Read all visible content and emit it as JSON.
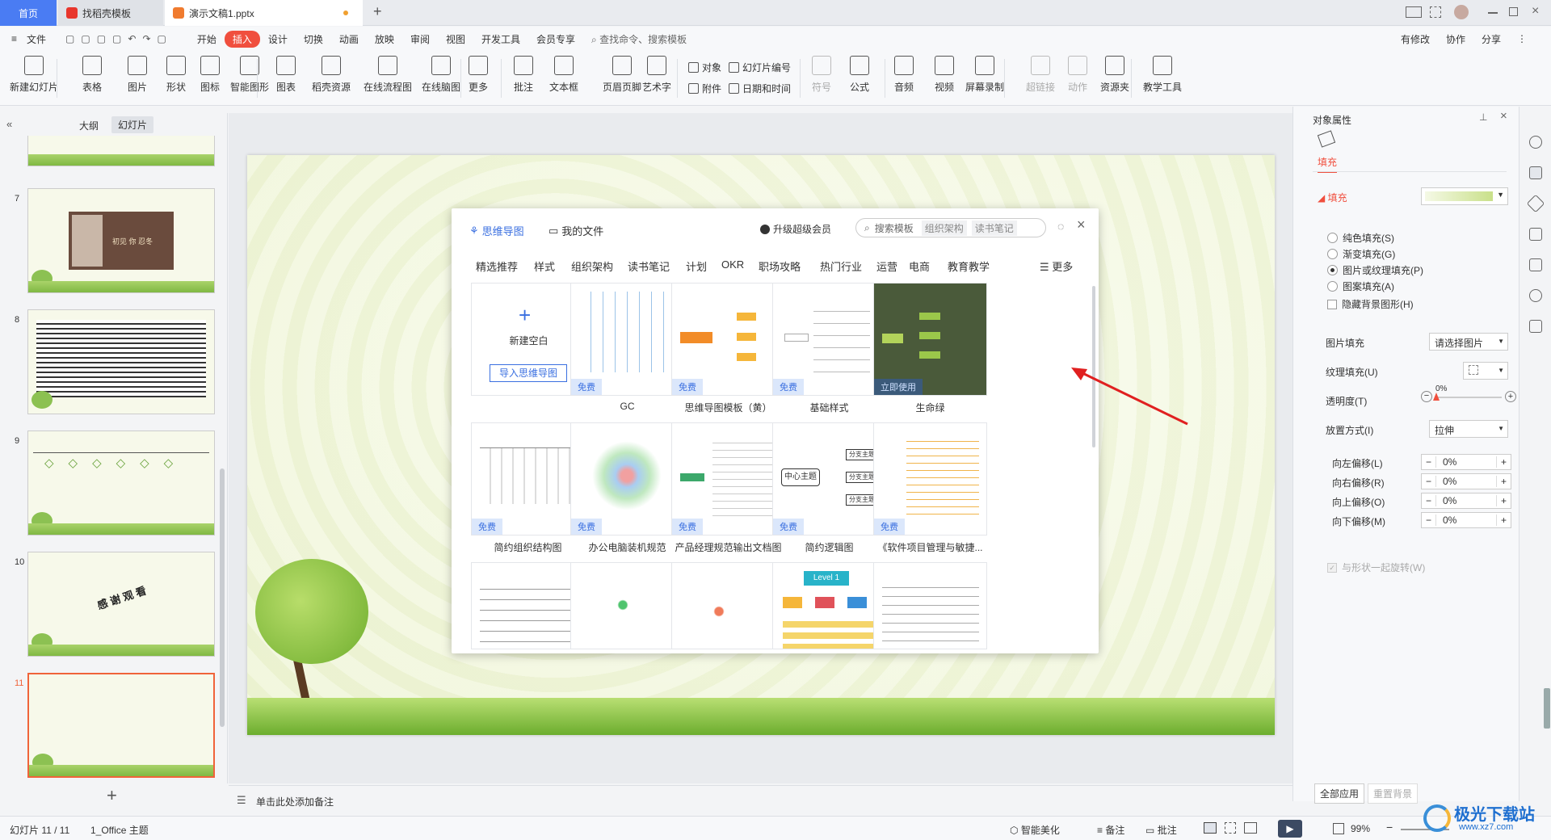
{
  "titlebar": {
    "home_tab": "首页",
    "tab1": "找稻壳模板",
    "tab2": "演示文稿1.pptx",
    "add_tab": "+"
  },
  "menubar": {
    "file": "文件",
    "items": [
      "开始",
      "插入",
      "设计",
      "切换",
      "动画",
      "放映",
      "审阅",
      "视图",
      "开发工具",
      "会员专享"
    ],
    "active": "插入",
    "search_placeholder": "查找命令、搜索模板",
    "right": [
      "有修改",
      "协作",
      "分享"
    ]
  },
  "ribbon": {
    "buttons": [
      "新建幻灯片",
      "表格",
      "图片",
      "形状",
      "图标",
      "智能图形",
      "图表",
      "稻壳资源",
      "在线流程图",
      "在线脑图",
      "更多",
      "批注",
      "文本框",
      "页眉页脚",
      "艺术字",
      "符号",
      "公式",
      "音频",
      "视频",
      "屏幕录制",
      "超链接",
      "动作",
      "资源夹",
      "教学工具"
    ],
    "small": [
      "对象",
      "幻灯片编号",
      "附件",
      "日期和时间"
    ]
  },
  "leftpanel": {
    "tab_outline": "大纲",
    "tab_slides": "幻灯片",
    "slides": [
      "7",
      "8",
      "9",
      "10",
      "11"
    ],
    "slide7_text": "初见 你 忍冬",
    "slide10_text": "感 谢 观 看",
    "add_slide": "+"
  },
  "dialog": {
    "tab_mindmap": "思维导图",
    "tab_myfiles": "我的文件",
    "upgrade": "升级超级会员",
    "search_placeholder": "搜索模板",
    "search_tags": [
      "组织架构",
      "读书笔记"
    ],
    "categories": [
      "精选推荐",
      "样式",
      "组织架构",
      "读书笔记",
      "计划",
      "OKR",
      "职场攻略",
      "热门行业",
      "运营",
      "电商",
      "教育教学"
    ],
    "more": "更多",
    "new_blank": "新建空白",
    "import": "导入思维导图",
    "free": "免费",
    "use_now": "立即使用",
    "row1_labels": [
      "GC",
      "思维导图模板（黄）",
      "基础样式",
      "生命绿"
    ],
    "row2_labels": [
      "简约组织结构图",
      "办公电脑装机规范",
      "产品经理规范输出文档图",
      "简约逻辑图",
      "《软件项目管理与敏捷..."
    ],
    "center_topic": "中心主题",
    "branch_topic": "分支主题",
    "level1": "Level 1"
  },
  "rightpanel": {
    "title": "对象属性",
    "tab_fill": "填充",
    "section_fill": "填充",
    "radio_options": [
      "纯色填充(S)",
      "渐变填充(G)",
      "图片或纹理填充(P)",
      "图案填充(A)"
    ],
    "selected_radio": 2,
    "hide_bg": "隐藏背景图形(H)",
    "picture_fill_label": "图片填充",
    "picture_fill_value": "请选择图片",
    "texture_fill_label": "纹理填充(U)",
    "transparency_label": "透明度(T)",
    "transparency_value": "0%",
    "placement_label": "放置方式(I)",
    "placement_value": "拉伸",
    "offsets": [
      {
        "label": "向左偏移(L)",
        "value": "0%"
      },
      {
        "label": "向右偏移(R)",
        "value": "0%"
      },
      {
        "label": "向上偏移(O)",
        "value": "0%"
      },
      {
        "label": "向下偏移(M)",
        "value": "0%"
      }
    ],
    "rotate_with_shape": "与形状一起旋转(W)",
    "apply_all": "全部应用",
    "reset_bg": "重置背景"
  },
  "notes": {
    "placeholder": "单击此处添加备注"
  },
  "statusbar": {
    "slide_info": "幻灯片 11 / 11",
    "theme": "1_Office 主题",
    "smart_beautify": "智能美化",
    "notes": "备注",
    "comments": "批注",
    "zoom": "99%"
  },
  "watermark": {
    "text": "极光下载站",
    "url": "www.xz7.com"
  },
  "colors": {
    "accent": "#4a7cf3",
    "insert_tab": "#f04f3e",
    "selected_slide": "#f0633a",
    "green_card": "#4a5a3a",
    "arrow": "#e02020"
  }
}
